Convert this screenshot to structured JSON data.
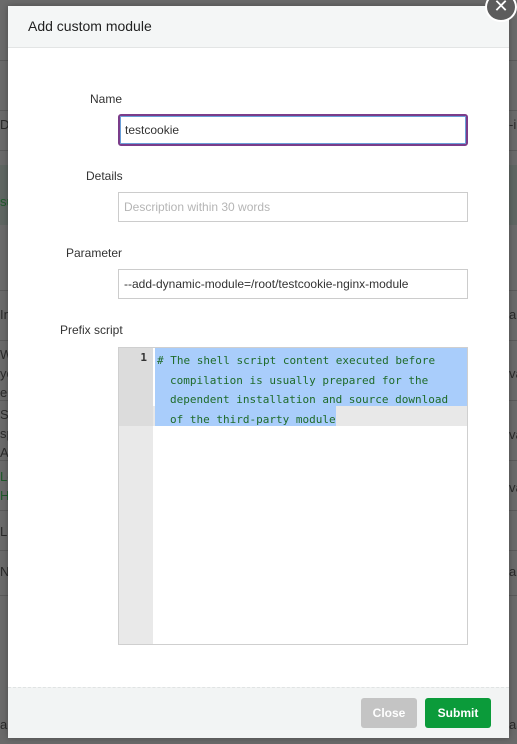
{
  "background": {
    "left_fragments": [
      "D",
      "su",
      "In",
      "W\nyo\ne",
      "St\nsp\nAp",
      "Lo\nH",
      "Li",
      "N",
      "a"
    ],
    "right_fragments": [
      "-ir",
      "al",
      "va",
      "va",
      "va",
      "al",
      "aa"
    ]
  },
  "modal": {
    "title": "Add custom module",
    "close_icon": "close-icon",
    "fields": {
      "name": {
        "label": "Name",
        "value": "testcookie",
        "placeholder": ""
      },
      "details": {
        "label": "Details",
        "value": "",
        "placeholder": "Description within 30 words"
      },
      "parameter": {
        "label": "Parameter",
        "value": "--add-dynamic-module=/root/testcookie-nginx-module",
        "placeholder": ""
      },
      "prefix_script": {
        "label": "Prefix script",
        "line_number": "1",
        "content": "# The shell script content executed before compilation is usually prepared for the dependent installation and source download of the third-party module"
      }
    },
    "footer": {
      "close_label": "Close",
      "submit_label": "Submit"
    }
  },
  "colors": {
    "submit": "#0b9b3a",
    "close_disabled": "#c4c4c4",
    "focus_border": "#7b3c8a",
    "code_text": "#1f6b2a",
    "selection": "#a9cdfb"
  }
}
